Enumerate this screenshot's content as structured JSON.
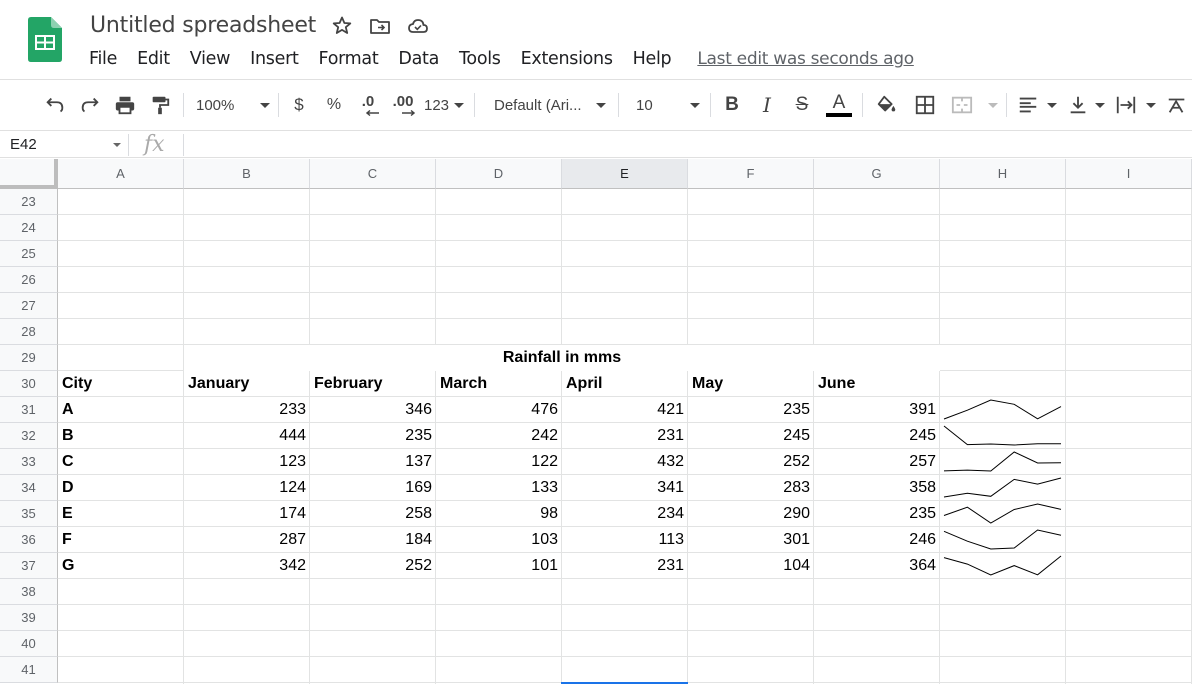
{
  "title": "Untitled spreadsheet",
  "menu": [
    "File",
    "Edit",
    "View",
    "Insert",
    "Format",
    "Data",
    "Tools",
    "Extensions",
    "Help"
  ],
  "last_edit": "Last edit was seconds ago",
  "toolbar": {
    "zoom": "100%",
    "currency": "$",
    "percent": "%",
    "dec_decrease": ".0",
    "dec_increase": ".00",
    "more_formats": "123",
    "font": "Default (Ari...",
    "font_size": "10",
    "bold": "B",
    "italic": "I",
    "strike": "S",
    "text_color": "A"
  },
  "formula": {
    "namebox": "E42",
    "fx": "fx",
    "value": ""
  },
  "columns": [
    "A",
    "B",
    "C",
    "D",
    "E",
    "F",
    "G",
    "H",
    "I"
  ],
  "selected_column": "E",
  "rows": [
    "23",
    "24",
    "25",
    "26",
    "27",
    "28",
    "29",
    "30",
    "31",
    "32",
    "33",
    "34",
    "35",
    "36",
    "37",
    "38",
    "39",
    "40",
    "41"
  ],
  "sheet": {
    "title": "Rainfall in mms",
    "headers": [
      "City",
      "January",
      "February",
      "March",
      "April",
      "May",
      "June"
    ],
    "data": [
      {
        "city": "A",
        "values": [
          233,
          346,
          476,
          421,
          235,
          391
        ]
      },
      {
        "city": "B",
        "values": [
          444,
          235,
          242,
          231,
          245,
          245
        ]
      },
      {
        "city": "C",
        "values": [
          123,
          137,
          122,
          432,
          252,
          257
        ]
      },
      {
        "city": "D",
        "values": [
          124,
          169,
          133,
          341,
          283,
          358
        ]
      },
      {
        "city": "E",
        "values": [
          174,
          258,
          98,
          234,
          290,
          235
        ]
      },
      {
        "city": "F",
        "values": [
          287,
          184,
          103,
          113,
          301,
          246
        ]
      },
      {
        "city": "G",
        "values": [
          342,
          252,
          101,
          231,
          104,
          364
        ]
      }
    ]
  },
  "colors": {
    "sheets_green": "#0f9d58",
    "selection_blue": "#1a73e8",
    "sparkline": "#000000"
  }
}
